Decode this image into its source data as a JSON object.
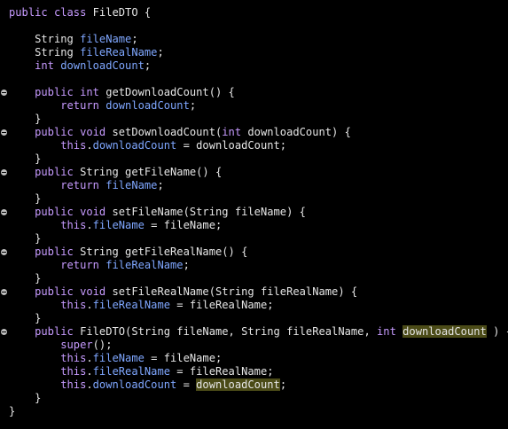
{
  "colors": {
    "background": "#000000",
    "keyword": "#c79bff",
    "field": "#7fa7ff",
    "plain": "#e6e6e6",
    "highlight": "#4b4b17",
    "fold_marker": "#bdbdbd"
  },
  "icons": {
    "fold_marker": "collapse-minus-icon"
  },
  "code": {
    "lines": [
      {
        "fold": false,
        "tokens": [
          {
            "t": "public",
            "c": "kw"
          },
          {
            "t": " ",
            "c": "pl"
          },
          {
            "t": "class",
            "c": "kw"
          },
          {
            "t": " FileDTO {",
            "c": "pl"
          }
        ]
      },
      {
        "fold": false,
        "tokens": []
      },
      {
        "fold": false,
        "tokens": [
          {
            "t": "    String ",
            "c": "pl"
          },
          {
            "t": "fileName",
            "c": "fld"
          },
          {
            "t": ";",
            "c": "pl"
          }
        ]
      },
      {
        "fold": false,
        "tokens": [
          {
            "t": "    String ",
            "c": "pl"
          },
          {
            "t": "fileRealName",
            "c": "fld"
          },
          {
            "t": ";",
            "c": "pl"
          }
        ]
      },
      {
        "fold": false,
        "tokens": [
          {
            "t": "    ",
            "c": "pl"
          },
          {
            "t": "int",
            "c": "kw"
          },
          {
            "t": " ",
            "c": "pl"
          },
          {
            "t": "downloadCount",
            "c": "fld"
          },
          {
            "t": ";",
            "c": "pl"
          }
        ]
      },
      {
        "fold": false,
        "tokens": []
      },
      {
        "fold": true,
        "tokens": [
          {
            "t": "    ",
            "c": "pl"
          },
          {
            "t": "public",
            "c": "kw"
          },
          {
            "t": " ",
            "c": "pl"
          },
          {
            "t": "int",
            "c": "kw"
          },
          {
            "t": " getDownloadCount() {",
            "c": "pl"
          }
        ]
      },
      {
        "fold": false,
        "tokens": [
          {
            "t": "        ",
            "c": "pl"
          },
          {
            "t": "return",
            "c": "kw"
          },
          {
            "t": " ",
            "c": "pl"
          },
          {
            "t": "downloadCount",
            "c": "fld"
          },
          {
            "t": ";",
            "c": "pl"
          }
        ]
      },
      {
        "fold": false,
        "tokens": [
          {
            "t": "    }",
            "c": "pl"
          }
        ]
      },
      {
        "fold": true,
        "tokens": [
          {
            "t": "    ",
            "c": "pl"
          },
          {
            "t": "public",
            "c": "kw"
          },
          {
            "t": " ",
            "c": "pl"
          },
          {
            "t": "void",
            "c": "kw"
          },
          {
            "t": " setDownloadCount(",
            "c": "pl"
          },
          {
            "t": "int",
            "c": "kw"
          },
          {
            "t": " downloadCount) {",
            "c": "pl"
          }
        ]
      },
      {
        "fold": false,
        "tokens": [
          {
            "t": "        ",
            "c": "pl"
          },
          {
            "t": "this",
            "c": "kw"
          },
          {
            "t": ".",
            "c": "pl"
          },
          {
            "t": "downloadCount",
            "c": "fld"
          },
          {
            "t": " = downloadCount;",
            "c": "pl"
          }
        ]
      },
      {
        "fold": false,
        "tokens": [
          {
            "t": "    }",
            "c": "pl"
          }
        ]
      },
      {
        "fold": true,
        "tokens": [
          {
            "t": "    ",
            "c": "pl"
          },
          {
            "t": "public",
            "c": "kw"
          },
          {
            "t": " String getFileName() {",
            "c": "pl"
          }
        ]
      },
      {
        "fold": false,
        "tokens": [
          {
            "t": "        ",
            "c": "pl"
          },
          {
            "t": "return",
            "c": "kw"
          },
          {
            "t": " ",
            "c": "pl"
          },
          {
            "t": "fileName",
            "c": "fld"
          },
          {
            "t": ";",
            "c": "pl"
          }
        ]
      },
      {
        "fold": false,
        "tokens": [
          {
            "t": "    }",
            "c": "pl"
          }
        ]
      },
      {
        "fold": true,
        "tokens": [
          {
            "t": "    ",
            "c": "pl"
          },
          {
            "t": "public",
            "c": "kw"
          },
          {
            "t": " ",
            "c": "pl"
          },
          {
            "t": "void",
            "c": "kw"
          },
          {
            "t": " setFileName(String fileName) {",
            "c": "pl"
          }
        ]
      },
      {
        "fold": false,
        "tokens": [
          {
            "t": "        ",
            "c": "pl"
          },
          {
            "t": "this",
            "c": "kw"
          },
          {
            "t": ".",
            "c": "pl"
          },
          {
            "t": "fileName",
            "c": "fld"
          },
          {
            "t": " = fileName;",
            "c": "pl"
          }
        ]
      },
      {
        "fold": false,
        "tokens": [
          {
            "t": "    }",
            "c": "pl"
          }
        ]
      },
      {
        "fold": true,
        "tokens": [
          {
            "t": "    ",
            "c": "pl"
          },
          {
            "t": "public",
            "c": "kw"
          },
          {
            "t": " String getFileRealName() {",
            "c": "pl"
          }
        ]
      },
      {
        "fold": false,
        "tokens": [
          {
            "t": "        ",
            "c": "pl"
          },
          {
            "t": "return",
            "c": "kw"
          },
          {
            "t": " ",
            "c": "pl"
          },
          {
            "t": "fileRealName",
            "c": "fld"
          },
          {
            "t": ";",
            "c": "pl"
          }
        ]
      },
      {
        "fold": false,
        "tokens": [
          {
            "t": "    }",
            "c": "pl"
          }
        ]
      },
      {
        "fold": true,
        "tokens": [
          {
            "t": "    ",
            "c": "pl"
          },
          {
            "t": "public",
            "c": "kw"
          },
          {
            "t": " ",
            "c": "pl"
          },
          {
            "t": "void",
            "c": "kw"
          },
          {
            "t": " setFileRealName(String fileRealName) {",
            "c": "pl"
          }
        ]
      },
      {
        "fold": false,
        "tokens": [
          {
            "t": "        ",
            "c": "pl"
          },
          {
            "t": "this",
            "c": "kw"
          },
          {
            "t": ".",
            "c": "pl"
          },
          {
            "t": "fileRealName",
            "c": "fld"
          },
          {
            "t": " = fileRealName;",
            "c": "pl"
          }
        ]
      },
      {
        "fold": false,
        "tokens": [
          {
            "t": "    }",
            "c": "pl"
          }
        ]
      },
      {
        "fold": true,
        "tokens": [
          {
            "t": "    ",
            "c": "pl"
          },
          {
            "t": "public",
            "c": "kw"
          },
          {
            "t": " FileDTO(String fileName, String fileRealName, ",
            "c": "pl"
          },
          {
            "t": "int",
            "c": "kw"
          },
          {
            "t": " ",
            "c": "pl"
          },
          {
            "t": "downloadCount",
            "c": "pl",
            "hl": true
          },
          {
            "t": " ) {",
            "c": "pl"
          }
        ]
      },
      {
        "fold": false,
        "tokens": [
          {
            "t": "        ",
            "c": "pl"
          },
          {
            "t": "super",
            "c": "kw"
          },
          {
            "t": "();",
            "c": "pl"
          }
        ]
      },
      {
        "fold": false,
        "tokens": [
          {
            "t": "        ",
            "c": "pl"
          },
          {
            "t": "this",
            "c": "kw"
          },
          {
            "t": ".",
            "c": "pl"
          },
          {
            "t": "fileName",
            "c": "fld"
          },
          {
            "t": " = fileName;",
            "c": "pl"
          }
        ]
      },
      {
        "fold": false,
        "tokens": [
          {
            "t": "        ",
            "c": "pl"
          },
          {
            "t": "this",
            "c": "kw"
          },
          {
            "t": ".",
            "c": "pl"
          },
          {
            "t": "fileRealName",
            "c": "fld"
          },
          {
            "t": " = fileRealName;",
            "c": "pl"
          }
        ]
      },
      {
        "fold": false,
        "tokens": [
          {
            "t": "        ",
            "c": "pl"
          },
          {
            "t": "this",
            "c": "kw"
          },
          {
            "t": ".",
            "c": "pl"
          },
          {
            "t": "downloadCount",
            "c": "fld"
          },
          {
            "t": " = ",
            "c": "pl"
          },
          {
            "t": "downloadCount",
            "c": "pl",
            "hl": true
          },
          {
            "t": ";",
            "c": "pl"
          }
        ]
      },
      {
        "fold": false,
        "tokens": [
          {
            "t": "    }",
            "c": "pl"
          }
        ]
      },
      {
        "fold": false,
        "tokens": [
          {
            "t": "}",
            "c": "pl"
          }
        ]
      }
    ]
  }
}
